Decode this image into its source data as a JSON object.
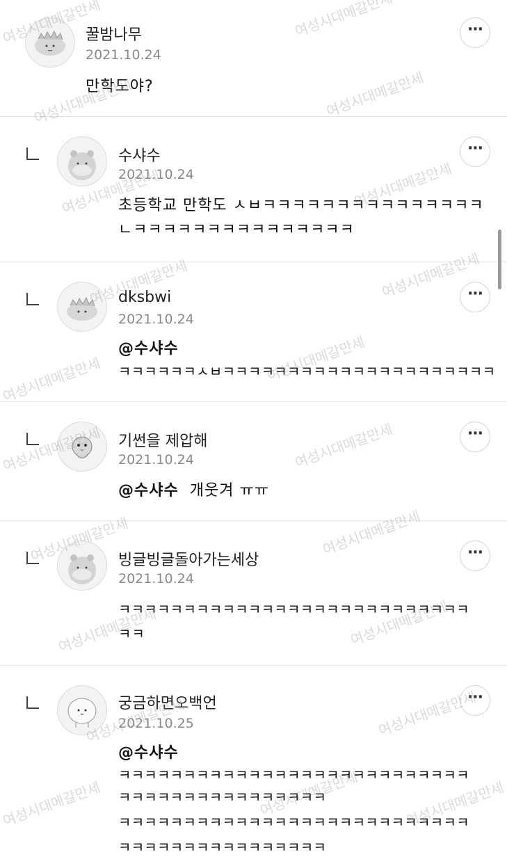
{
  "watermark_text": "여성시대메갈만세",
  "more_button_label": "···",
  "comments": [
    {
      "name": "꿀밤나무",
      "date": "2021.10.24",
      "lines": [
        "만학도야?"
      ],
      "avatar": "dino-avatar"
    },
    {
      "name": "수샤수",
      "date": "2021.10.24",
      "lines": [
        "초등학교 만학도 ㅅㅂㅋㅋㅋㅋㅋㅋㅋㅋㅋㅋㅋㅋㅋㅋㅋ",
        "ㄴㅋㅋㅋㅋㅋㅋㅋㅋㅋㅋㅋㅋㅋㅋㅋ"
      ],
      "avatar": "hamster-avatar"
    },
    {
      "name": "dksbwi",
      "date": "2021.10.24",
      "mention": "@수샤수",
      "lines": [
        "ㅋㅋㅋㅋㅋㅋㅅㅂㅋㅋㅋㅋㅋㅋㅋㅋㅋㅋㅋㅋㅋㅋㅋㅋㅋㅋㅋㅋㅋ"
      ],
      "avatar": "dino-avatar"
    },
    {
      "name": "기썬을 제압해",
      "date": "2021.10.24",
      "mention": "@수샤수",
      "lines": [
        "개웃겨 ㅠㅠ"
      ],
      "avatar": "chick-avatar"
    },
    {
      "name": "빙글빙글돌아가는세상",
      "date": "2021.10.24",
      "lines": [
        "ㅋㅋㅋㅋㅋㅋㅋㅋㅋㅋㅋㅋㅋㅋㅋㅋㅋㅋㅋㅋㅋㅋㅋㅋㅋㅋㅋ",
        "ㅋㅋ"
      ],
      "avatar": "hamster-avatar"
    },
    {
      "name": "궁금하면오백언",
      "date": "2021.10.25",
      "mention": "@수샤수",
      "lines": [
        "ㅋㅋㅋㅋㅋㅋㅋㅋㅋㅋㅋㅋㅋㅋㅋㅋㅋㅋㅋㅋㅋㅋㅋㅋㅋㅋㅋ",
        "ㅋㅋㅋㅋㅋㅋㅋㅋㅋㅋㅋㅋㅋㅋㅋㅋ",
        "ㅋㅋㅋㅋㅋㅋㅋㅋㅋㅋㅋㅋㅋㅋㅋㅋㅋㅋㅋㅋㅋㅋㅋㅋㅋㅋㅋ",
        "ㅋㅋㅋㅋㅋㅋㅋㅋㅋㅋㅋㅋㅋㅋㅋㅋ"
      ],
      "avatar": "bean-avatar"
    }
  ]
}
